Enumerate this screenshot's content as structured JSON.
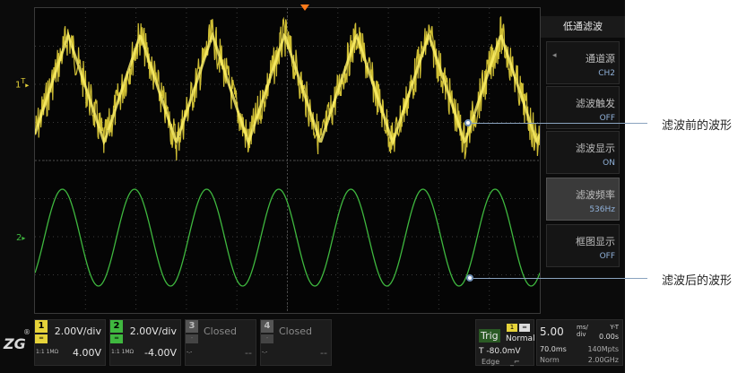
{
  "menu": {
    "title": "低通滤波",
    "items": [
      {
        "label": "通道源",
        "value": "CH2"
      },
      {
        "label": "滤波触发",
        "value": "OFF"
      },
      {
        "label": "滤波显示",
        "value": "ON"
      },
      {
        "label": "滤波频率",
        "value": "536Hz"
      },
      {
        "label": "框图显示",
        "value": "OFF"
      }
    ]
  },
  "markers": {
    "ch1": "1",
    "ch1_trig": "T",
    "ch2": "2"
  },
  "channels": [
    {
      "num": "1",
      "coupling": "DC",
      "scale": "2.00V/div",
      "offset": "4.00V",
      "impedance": "1:1 1MΩ",
      "color": "#e6d33a"
    },
    {
      "num": "2",
      "coupling": "DC",
      "scale": "2.00V/div",
      "offset": "-4.00V",
      "impedance": "1:1 1MΩ",
      "color": "#3fb83f"
    },
    {
      "num": "3",
      "coupling": "-",
      "scale": "Closed",
      "offset": "--",
      "impedance": "-.-",
      "color": "#555555"
    },
    {
      "num": "4",
      "coupling": "-",
      "scale": "Closed",
      "offset": "--",
      "impedance": "-.-",
      "color": "#555555"
    }
  ],
  "trigger": {
    "label": "Trig",
    "source": "1",
    "mode": "Normal",
    "level": "T   -80.0mV",
    "type": "Edge"
  },
  "timebase": {
    "scale": "5.00",
    "unit_top": "ms/",
    "unit_bottom": "div",
    "mode": "Y-T",
    "position": "0.00s",
    "length": "70.0ms",
    "sample_rate": "140Mpts",
    "acq": "Norm",
    "bandwidth": "2.00GHz"
  },
  "logo": {
    "text": "ZG",
    "reg": "®"
  },
  "annotations": {
    "before": "滤波前的波形",
    "after": "滤波后的波形"
  },
  "colors": {
    "ch1": "#e6d33a",
    "ch2": "#3fb83f",
    "grid": "#3a3a3a",
    "trigger_marker": "#ff7a1a"
  }
}
